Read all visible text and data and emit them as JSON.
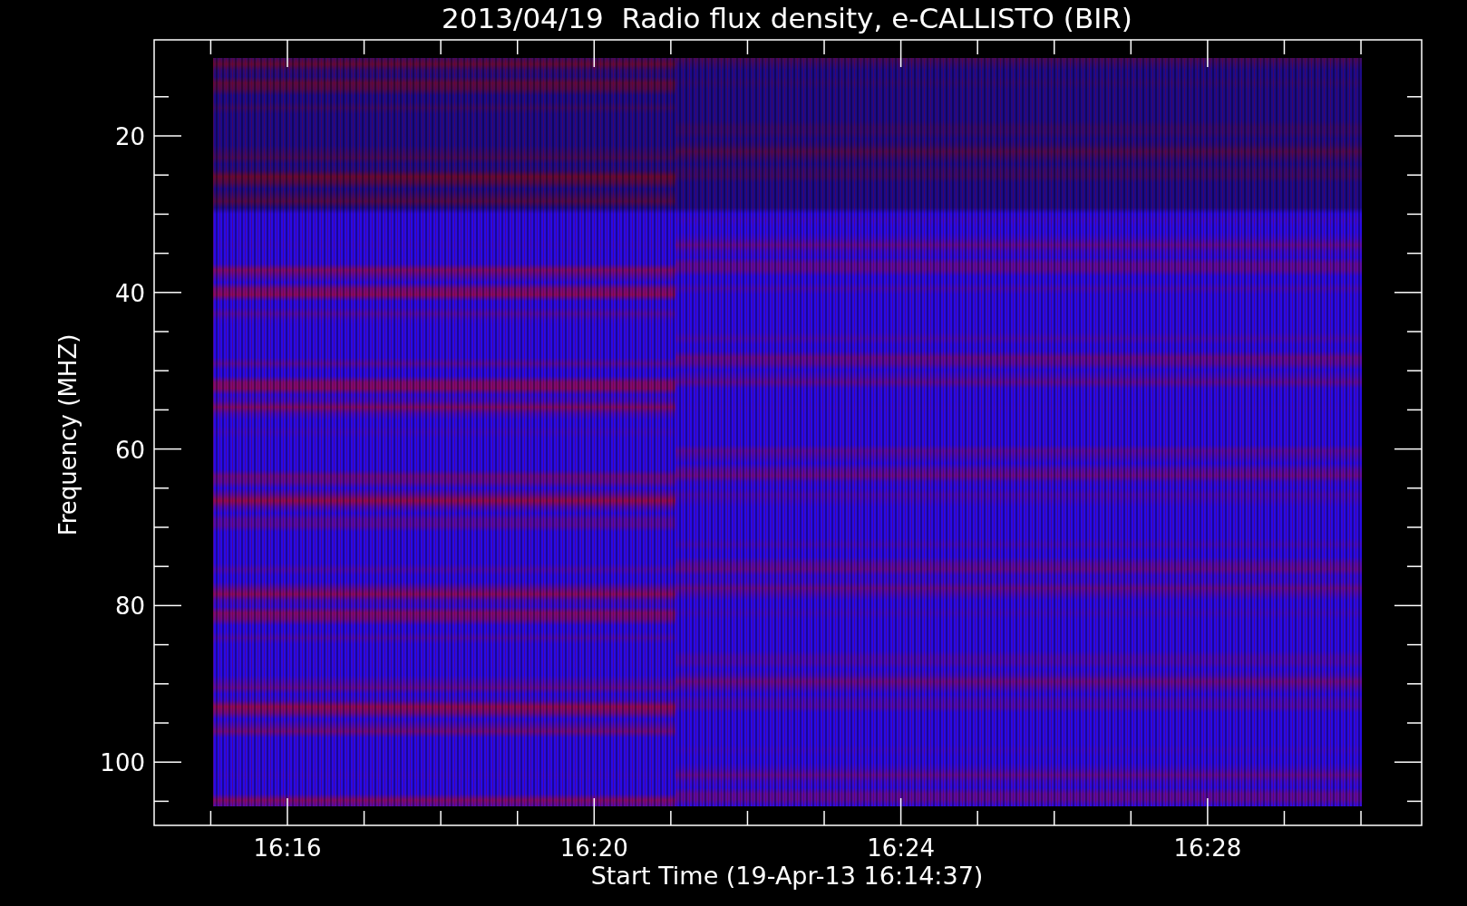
{
  "plot": {
    "title": "2013/04/19  Radio flux density, e-CALLISTO (BIR)",
    "ylabel": "Frequency (MHZ)",
    "xlabel": "Start Time (19-Apr-13 16:14:37)",
    "yticks": [
      "20",
      "40",
      "60",
      "80",
      "100"
    ],
    "xticks": [
      "16:16",
      "16:20",
      "16:24",
      "16:28"
    ]
  }
}
